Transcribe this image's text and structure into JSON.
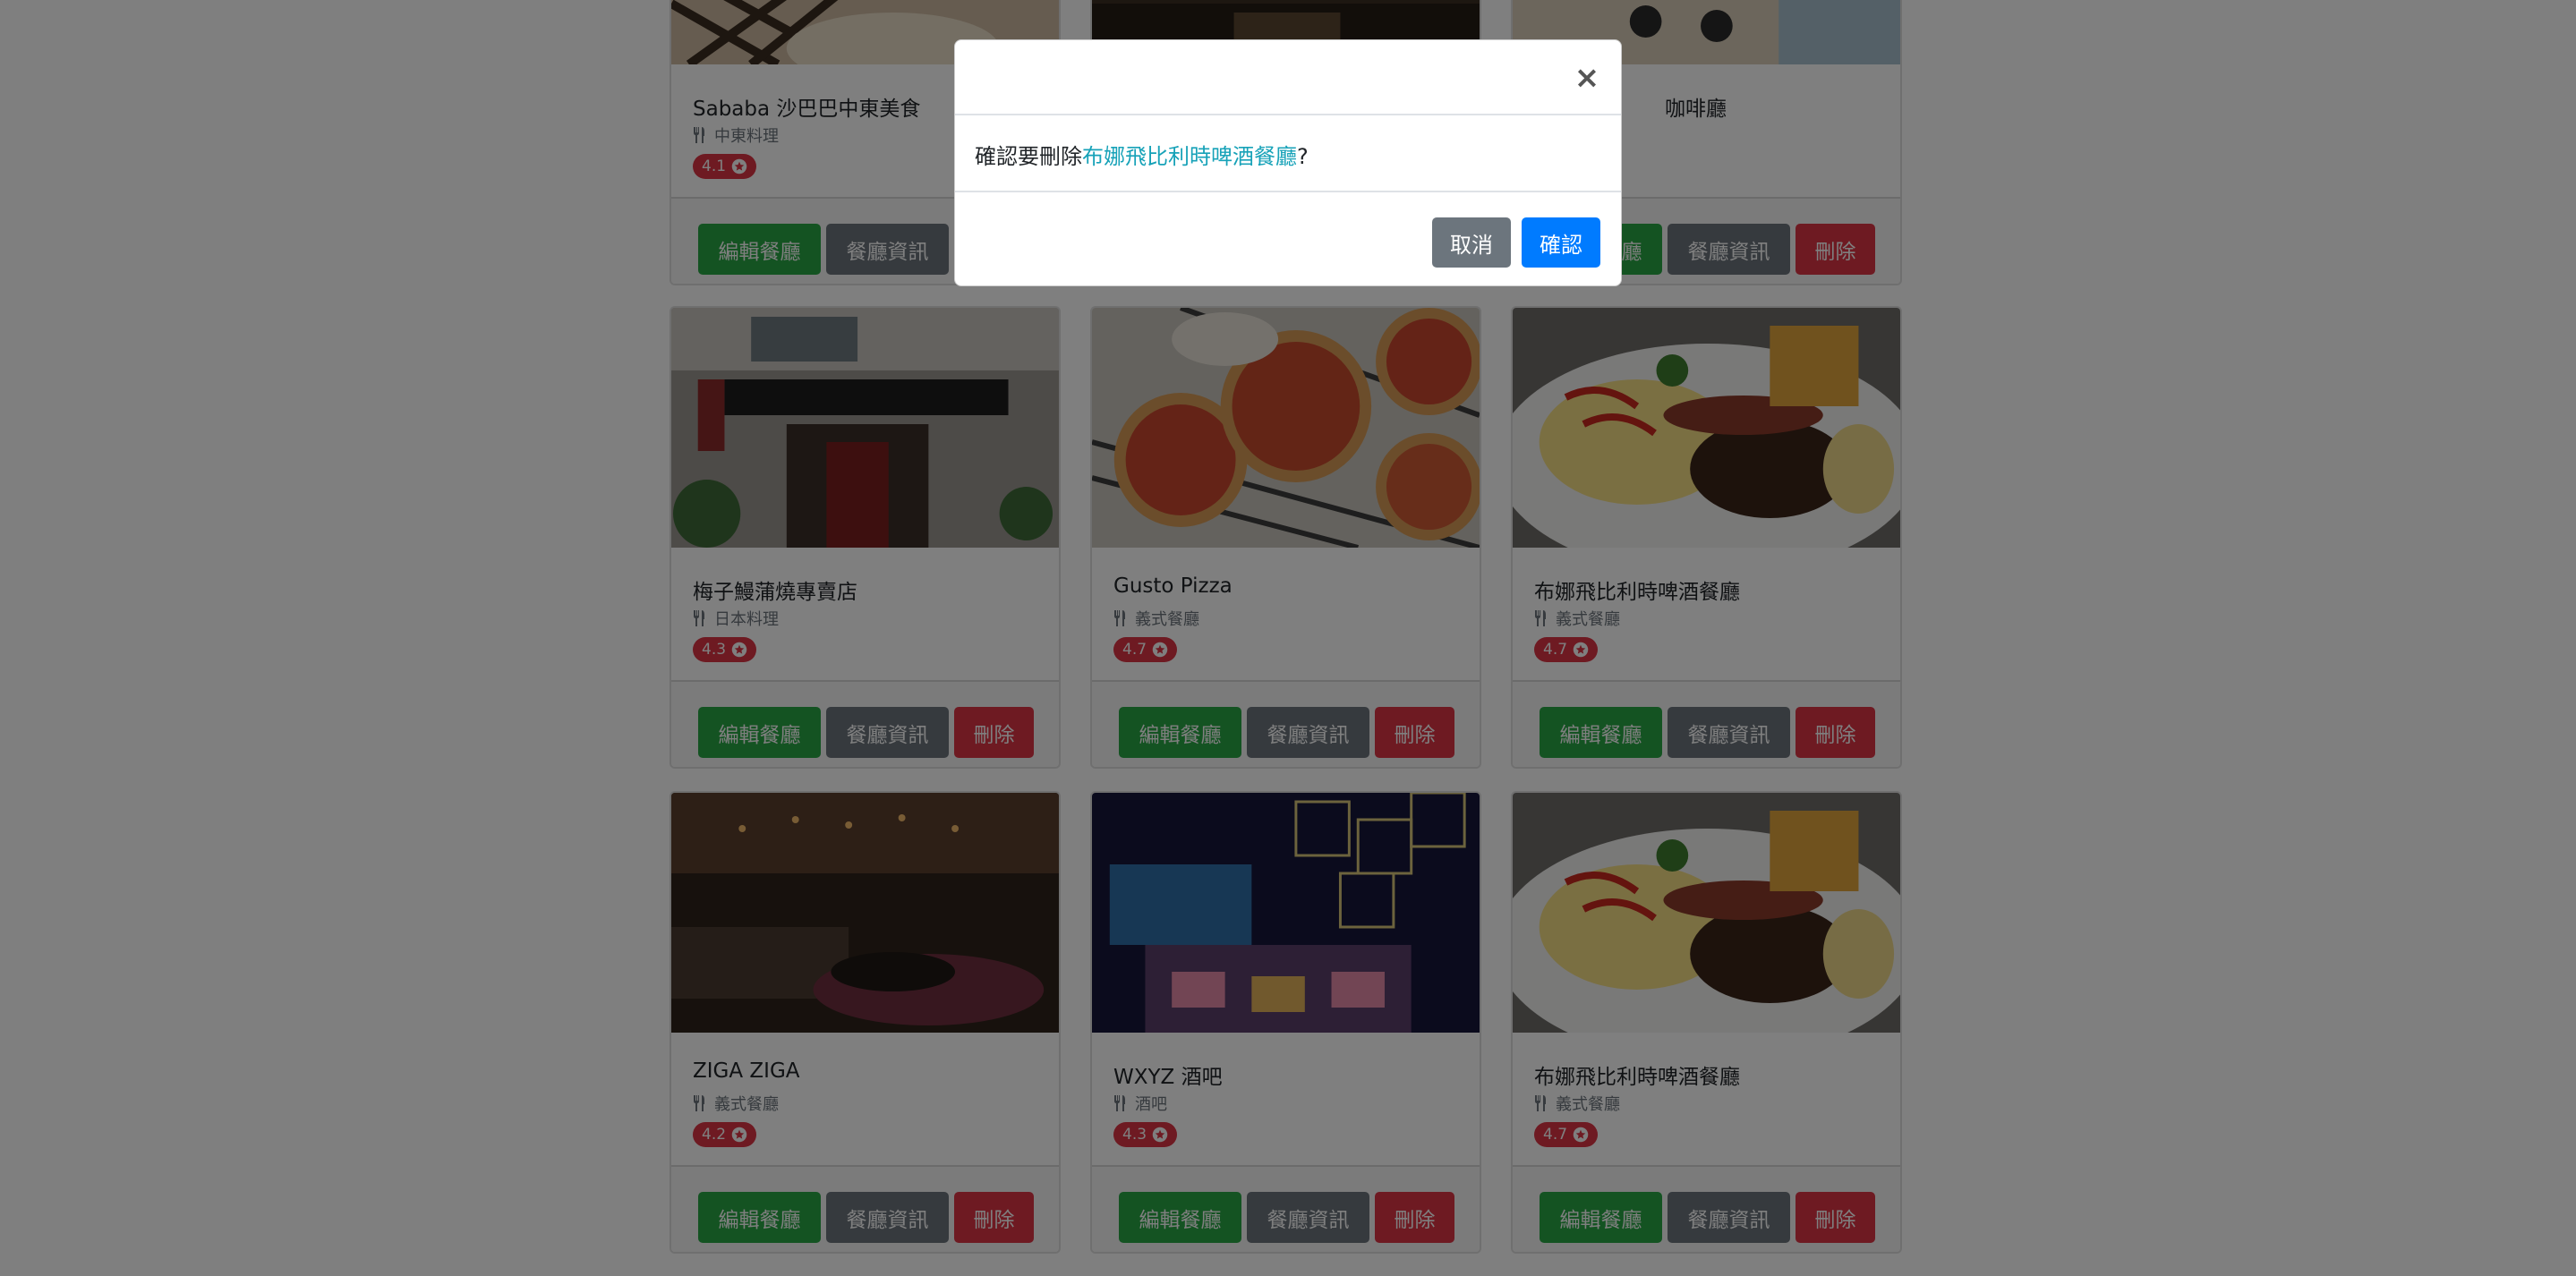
{
  "restaurants": [
    {
      "name": "Sababa 沙巴巴中東美食",
      "category": "中東料理",
      "rating": "4.1"
    },
    {
      "name": "",
      "category": "",
      "rating": ""
    },
    {
      "name": "咖啡廳",
      "category": "",
      "rating": ""
    },
    {
      "name": "梅子鰻蒲燒專賣店",
      "category": "日本料理",
      "rating": "4.3"
    },
    {
      "name": "Gusto Pizza",
      "category": "義式餐廳",
      "rating": "4.7"
    },
    {
      "name": "布娜飛比利時啤酒餐廳",
      "category": "義式餐廳",
      "rating": "4.7"
    },
    {
      "name": "ZIGA ZIGA",
      "category": "義式餐廳",
      "rating": "4.2"
    },
    {
      "name": "WXYZ 酒吧",
      "category": "酒吧",
      "rating": "4.3"
    },
    {
      "name": "布娜飛比利時啤酒餐廳",
      "category": "義式餐廳",
      "rating": "4.7"
    }
  ],
  "buttons": {
    "edit": "編輯餐廳",
    "info": "餐廳資訊",
    "delete": "刪除"
  },
  "modal": {
    "close": "×",
    "prompt_prefix": "確認要刪除",
    "target_name": "布娜飛比利時啤酒餐廳",
    "prompt_suffix": "?",
    "cancel": "取消",
    "confirm": "確認"
  },
  "colors": {
    "edit": "#28a745",
    "info": "#6c757d",
    "delete": "#dc3545",
    "confirm": "#007bff",
    "highlight": "#17a2b8"
  },
  "icons": {
    "category": "utensils-icon",
    "rating": "star-icon",
    "close": "close-icon"
  }
}
